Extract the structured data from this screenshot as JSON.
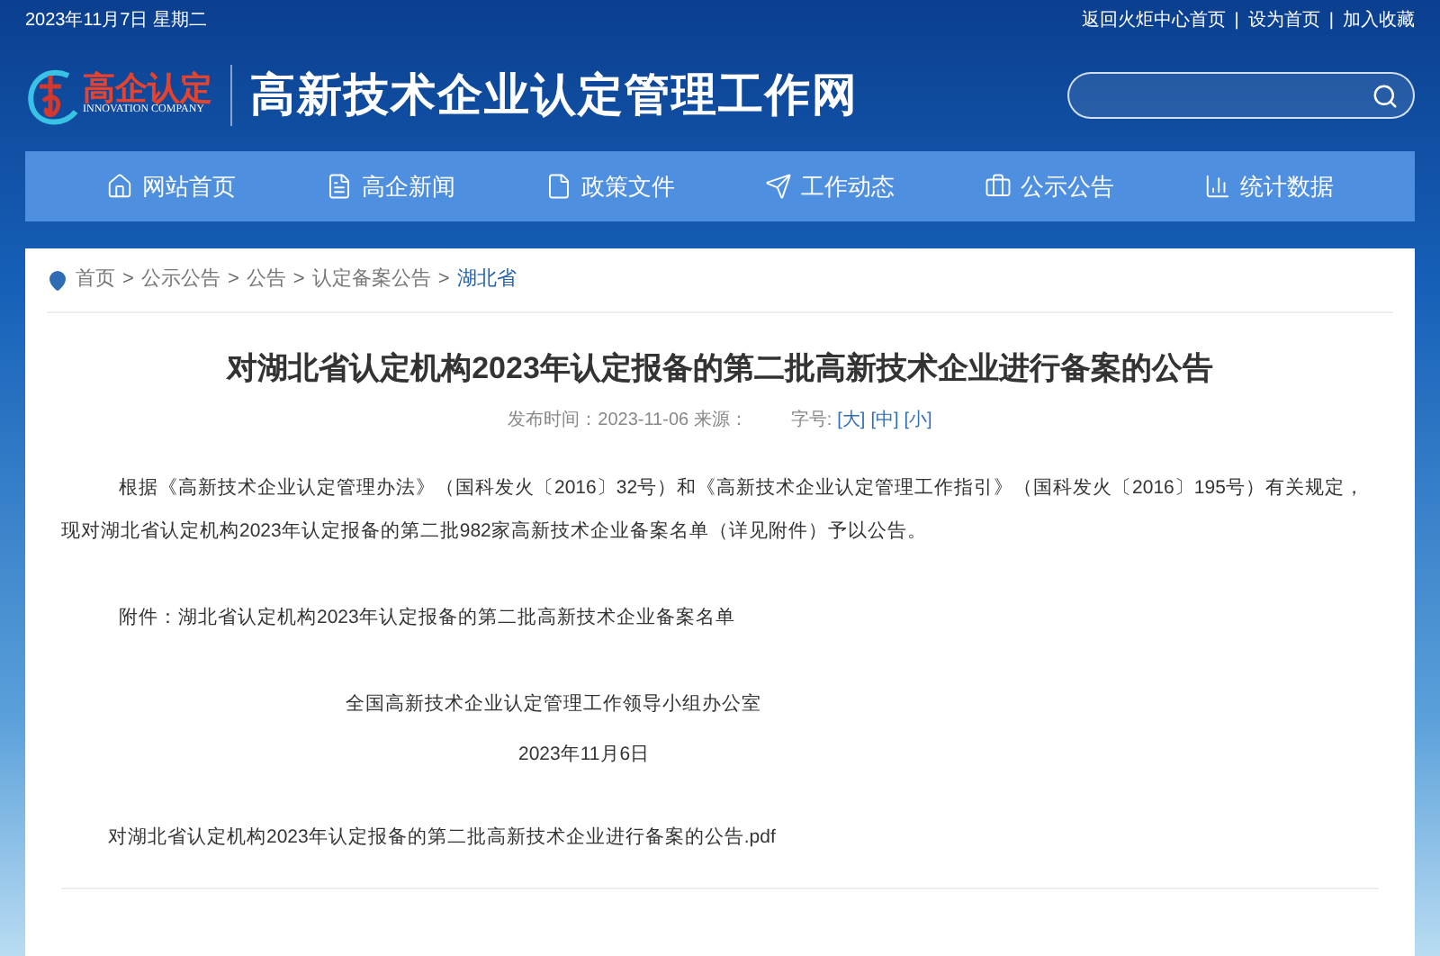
{
  "top_bar": {
    "date": "2023年11月7日 星期二",
    "links": [
      "返回火炬中心首页",
      "设为首页",
      "加入收藏"
    ],
    "divider": "|"
  },
  "header": {
    "logo_text": "高企认定",
    "logo_subtitle": "INNOVATION COMPANY",
    "site_title": "高新技术企业认定管理工作网"
  },
  "nav": [
    {
      "label": "网站首页"
    },
    {
      "label": "高企新闻"
    },
    {
      "label": "政策文件"
    },
    {
      "label": "工作动态"
    },
    {
      "label": "公示公告"
    },
    {
      "label": "统计数据"
    }
  ],
  "breadcrumb": {
    "separator": ">",
    "items": [
      {
        "label": "首页",
        "selected": false
      },
      {
        "label": "公示公告",
        "selected": false
      },
      {
        "label": "公告",
        "selected": false
      },
      {
        "label": "认定备案公告",
        "selected": false
      },
      {
        "label": "湖北省",
        "selected": true
      }
    ]
  },
  "article": {
    "title": "对湖北省认定机构2023年认定报备的第二批高新技术企业进行备案的公告",
    "meta": "发布时间：2023-11-06 来源：",
    "font_size_label": "字号:",
    "font_sizes": [
      "[大]",
      "[中]",
      "[小]"
    ],
    "body": [
      {
        "kind": "indent",
        "text": "根据《高新技术企业认定管理办法》（国科发火〔2016〕32号）和《高新技术企业认定管理工作指引》（国科发火〔2016〕195号）有关规定，现对湖北省认定机构2023年认定报备的第二批982家高新技术企业备案名单（详见附件）予以公告。"
      },
      {
        "kind": "indent",
        "text": "附件：湖北省认定机构2023年认定报备的第二批高新技术企业备案名单"
      },
      {
        "kind": "sign",
        "text": "全国高新技术企业认定管理工作领导小组办公室"
      },
      {
        "kind": "date",
        "text": "2023年11月6日"
      },
      {
        "kind": "attachment",
        "text": "对湖北省认定机构2023年认定报备的第二批高新技术企业进行备案的公告.pdf"
      }
    ]
  }
}
